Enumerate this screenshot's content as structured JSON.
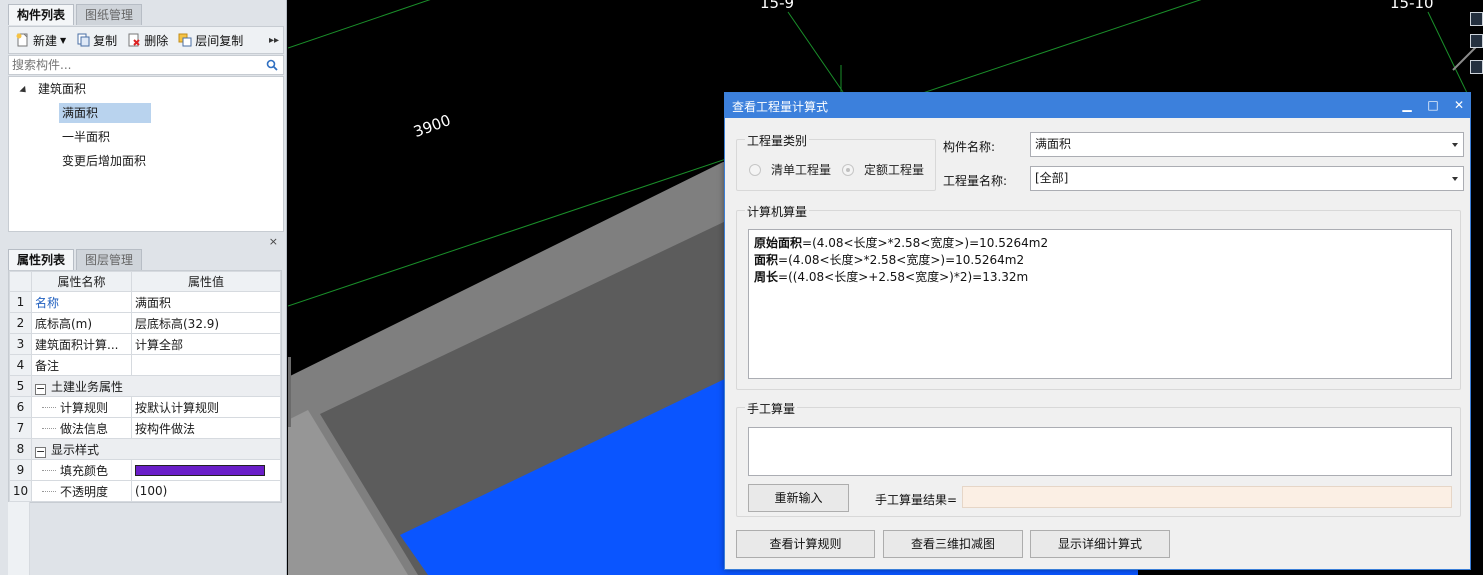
{
  "left_panel": {
    "top_tabs": [
      {
        "label": "构件列表"
      },
      {
        "label": "图纸管理"
      }
    ],
    "toolbar": {
      "new_label": "新建",
      "copy_label": "复制",
      "delete_label": "删除",
      "floor_copy_label": "层间复制",
      "more_glyph": "▸▸"
    },
    "search": {
      "placeholder": "搜索构件..."
    },
    "tree": {
      "root": "建筑面积",
      "children": [
        {
          "label": "满面积",
          "selected": true
        },
        {
          "label": "一半面积",
          "selected": false
        },
        {
          "label": "变更后增加面积",
          "selected": false
        }
      ]
    },
    "close_glyph": "×",
    "bottom_tabs": [
      {
        "label": "属性列表"
      },
      {
        "label": "图层管理"
      }
    ],
    "properties": {
      "headers": [
        "",
        "属性名称",
        "属性值"
      ],
      "rows": [
        {
          "idx": "1",
          "name": "名称",
          "value": "满面积"
        },
        {
          "idx": "2",
          "name": "底标高(m)",
          "value": "层底标高(32.9)"
        },
        {
          "idx": "3",
          "name": "建筑面积计算...",
          "value": "计算全部"
        },
        {
          "idx": "4",
          "name": "备注",
          "value": ""
        },
        {
          "idx": "5",
          "name": "土建业务属性",
          "value": ""
        },
        {
          "idx": "6",
          "name": "计算规则",
          "value": "按默认计算规则"
        },
        {
          "idx": "7",
          "name": "做法信息",
          "value": "按构件做法"
        },
        {
          "idx": "8",
          "name": "显示样式",
          "value": ""
        },
        {
          "idx": "9",
          "name": "填充颜色",
          "value": ""
        },
        {
          "idx": "10",
          "name": "不透明度",
          "value": "(100)"
        }
      ],
      "fill_color": "#6a1ec8"
    }
  },
  "canvas": {
    "grid_labels": [
      "15-9",
      "15-10",
      "3900"
    ],
    "floor_color": "#0a55ff",
    "wall_color": "#7f7f7f"
  },
  "dialog": {
    "title": "查看工程量计算式",
    "minimize_glyph": "▁",
    "maximize_glyph": "□",
    "close_glyph": "✕",
    "qty_type": {
      "legend": "工程量类别",
      "options": [
        {
          "label": "清单工程量",
          "selected": false
        },
        {
          "label": "定额工程量",
          "selected": true
        }
      ]
    },
    "component_name_label": "构件名称:",
    "component_name_value": "满面积",
    "qty_name_label": "工程量名称:",
    "qty_name_value": "[全部]",
    "computer_calc": {
      "legend": "计算机算量",
      "lines": [
        {
          "name": "原始面积",
          "expr": "=(4.08<长度>*2.58<宽度>)=10.5264m2"
        },
        {
          "name": "面积",
          "expr": "=(4.08<长度>*2.58<宽度>)=10.5264m2"
        },
        {
          "name": "周长",
          "expr": "=((4.08<长度>+2.58<宽度>)*2)=13.32m"
        }
      ]
    },
    "manual_calc": {
      "legend": "手工算量",
      "reinput_label": "重新输入",
      "result_label": "手工算量结果="
    },
    "buttons": {
      "view_rules": "查看计算规则",
      "view_3d": "查看三维扣减图",
      "show_detail": "显示详细计算式"
    }
  }
}
